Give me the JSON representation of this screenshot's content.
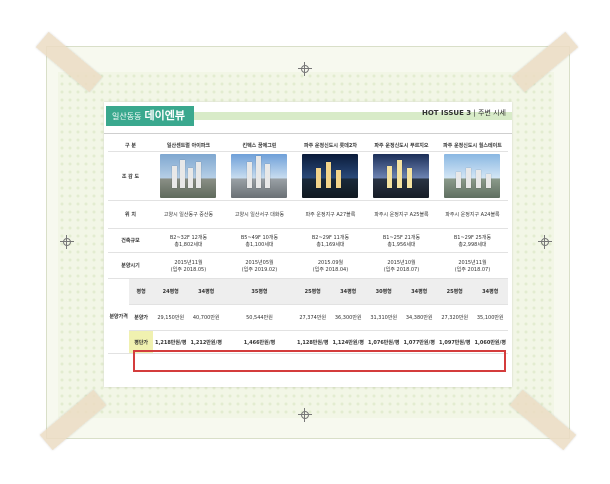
{
  "header": {
    "label_small": "일산동동",
    "label_big": "데이엔뷰",
    "right_issue": "HOT ISSUE 3",
    "right_sep": "|",
    "right_title": "주변 시세"
  },
  "table": {
    "col_header_label": "구 분",
    "complexes": [
      "일산센트럴 아이파크",
      "킨텍스 꿈에그린",
      "파주 운정신도시 롯데2차",
      "파주 운정신도시 푸르지오",
      "파주 운정신도시 힐스테이트"
    ],
    "row_labels": {
      "image": "조 감 도",
      "location": "위 치",
      "scale": "건축규모",
      "sale_period": "분양시기",
      "sale_price_group": "분양가격",
      "size": "평형",
      "price": "분양가",
      "per_pyeong": "평단가"
    },
    "location": [
      "고양시 일산동구 중산동",
      "고양시 일산서구 대화동",
      "파주 운정지구 A27블록",
      "파주시 운정지구 A25블록",
      "파주시 운정지구 A24블록"
    ],
    "scale": [
      [
        "B2~32F 12개동",
        "총1,802세대"
      ],
      [
        "B5~49F 10개동",
        "총1,100세대"
      ],
      [
        "B2~29F 11개동",
        "총1,169세대"
      ],
      [
        "B1~25F 21개동",
        "총1,956세대"
      ],
      [
        "B1~29F 25개동",
        "총2,998세대"
      ]
    ],
    "sale_period": [
      [
        "2015년11월",
        "(입주 2018.05)"
      ],
      [
        "2015년05월",
        "(입주 2019.02)"
      ],
      [
        "2015.09월",
        "(입주 2018.04)"
      ],
      [
        "2015년10월",
        "(입주 2018.07)"
      ],
      [
        "2015년11월",
        "(입주 2018.07)"
      ]
    ],
    "sizes": [
      "24평형",
      "34평형",
      "35평형",
      "25평형",
      "34평형",
      "30평형",
      "34평형",
      "25평형",
      "34평형"
    ],
    "prices": [
      "29,150만원",
      "40,700만원",
      "50,544만원",
      "27,374만원",
      "36,300만원",
      "31,310만원",
      "34,380만원",
      "27,320만원",
      "35,100만원"
    ],
    "per_pyeong": [
      "1,218만원/평",
      "1,212만원/평",
      "1,466만원/평",
      "1,128만원/평",
      "1,124만원/평",
      "1,076만원/평",
      "1,077만원/평",
      "1,097만원/평",
      "1,060만원/평"
    ]
  },
  "colors": {
    "accent_green": "#3aa88e",
    "highlight_border": "#d43c3c",
    "highlight_label_bg": "#f0f1b0"
  }
}
